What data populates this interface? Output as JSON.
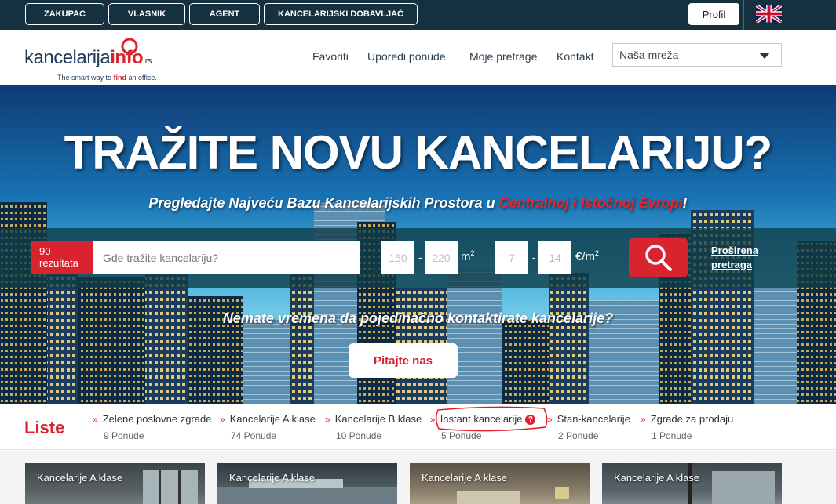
{
  "topbar": {
    "roles": [
      "ZAKUPAC",
      "VLASNIK",
      "AGENT",
      "KANCELARIJSKI DOBAVLJAČ"
    ],
    "profile_label": "Profil",
    "language_flag": "uk-flag-icon"
  },
  "logo": {
    "word": "kancelarija",
    "info": "info",
    "tld": ".rs",
    "tagline_pre": "The smart way to ",
    "tagline_find": "find",
    "tagline_post": " an office."
  },
  "nav": {
    "items": [
      "Favoriti",
      "Uporedi ponude",
      "Moje pretrage",
      "Kontakt"
    ],
    "network_select": "Naša mreža"
  },
  "hero": {
    "title": "TRAŽITE NOVU KANCELARIJU?",
    "subtitle_pre": "Pregledajte Najveću Bazu Kancelarijskih Prostora u ",
    "subtitle_highlight": "Centralnoj i Istočnoj Evropi",
    "subtitle_post": "!",
    "question": "Nemate vremena da pojedinačno kontaktirate kancelarije?",
    "ask_button": "Pitajte nas"
  },
  "search": {
    "results_count": "90",
    "results_label": "rezultata",
    "placeholder": "Gde tražite kancelariju?",
    "area_min": "150",
    "area_max": "220",
    "area_unit": "m",
    "area_unit_sup": "2",
    "price_min": "7",
    "price_max": "14",
    "price_unit": "€/m",
    "price_unit_sup": "2",
    "dash": "-",
    "advanced_line1": "Proširena",
    "advanced_line2": "pretraga",
    "search_icon": "search-icon"
  },
  "lists": {
    "title": "Liste",
    "items": [
      {
        "name": "Zelene poslovne zgrade",
        "count": "9 Ponude"
      },
      {
        "name": "Kancelarije A klase",
        "count": "74 Ponude"
      },
      {
        "name": "Kancelarije B klase",
        "count": "10 Ponude"
      },
      {
        "name": "Instant kancelarije",
        "count": "5 Ponude"
      },
      {
        "name": "Stan-kancelarije",
        "count": "2 Ponude"
      },
      {
        "name": "Zgrade za prodaju",
        "count": "1 Ponude"
      }
    ],
    "help_icon": "question-circle-icon"
  },
  "cards": [
    {
      "label": "Kancelarije A klase"
    },
    {
      "label": "Kancelarije A klase"
    },
    {
      "label": "Kancelarije A klase"
    },
    {
      "label": "Kancelarije A klase"
    }
  ],
  "colors": {
    "brand_red": "#d9232f",
    "topbar": "#15303f",
    "navy": "#1d3a5c"
  }
}
